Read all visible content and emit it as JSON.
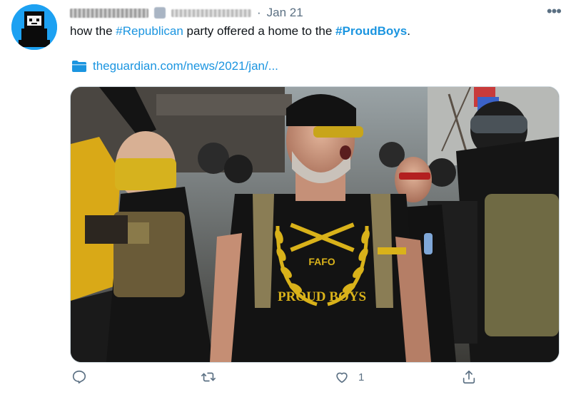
{
  "author": {
    "name": "Anonymous",
    "handle": "@anonymous",
    "timestamp": "Jan 21",
    "separator": "·"
  },
  "tweet": {
    "prefix": "how the ",
    "hashtag1": "#Republican",
    "middle": " party offered a home to the ",
    "hashtag2": "#ProudBoys",
    "suffix": "."
  },
  "link": {
    "text": "theguardian.com/news/2021/jan/..."
  },
  "photo": {
    "shirt_text_1": "FAFO",
    "shirt_text_2": "PROUD BOYS"
  },
  "actions": {
    "reply_count": "",
    "retweet_count": "",
    "like_count": "1",
    "share_count": ""
  },
  "icons": {
    "more": "more-horizontal-icon",
    "reply": "reply-icon",
    "retweet": "retweet-icon",
    "like": "heart-icon",
    "share": "share-icon",
    "link": "folder-link-icon"
  },
  "colors": {
    "link_blue": "#1b95e0",
    "muted": "#5b7083",
    "avatar_bg": "#1da1f2"
  }
}
